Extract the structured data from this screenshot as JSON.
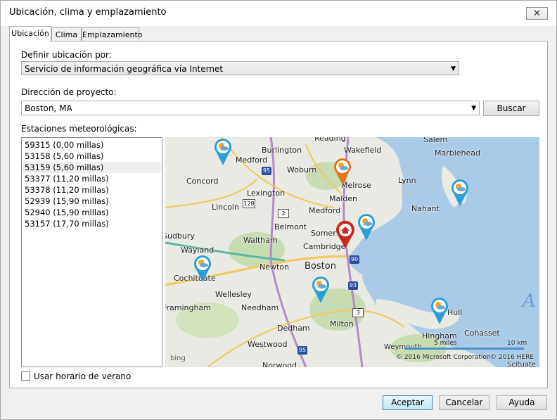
{
  "window": {
    "title": "Ubicación, clima y emplazamiento",
    "close": "✕"
  },
  "tabs": [
    {
      "label": "Ubicación"
    },
    {
      "label": "Clima"
    },
    {
      "label": "Emplazamiento"
    }
  ],
  "location": {
    "define_label": "Definir ubicación por:",
    "define_value": "Servicio de información geográfica vía Internet",
    "address_label": "Dirección de proyecto:",
    "address_value": "Boston, MA",
    "search_button": "Buscar"
  },
  "stations": {
    "label": "Estaciones meteorológicas:",
    "items": [
      "59315 (0,00 millas)",
      "53158 (5,60 millas)",
      "53159 (5,60 millas)",
      "53377 (11,20 millas)",
      "53378 (11,20 millas)",
      "52939 (15,90 millas)",
      "52940 (15,90 millas)",
      "53157 (17,70 millas)"
    ]
  },
  "map": {
    "places": [
      "Reading",
      "Wakefield",
      "Salem",
      "Burlington",
      "Medford",
      "Marblehead",
      "Woburn",
      "Concord",
      "Melrose",
      "Lynn",
      "Lexington",
      "Malden",
      "Nahant",
      "Lincoln",
      "Medford",
      "Belmont",
      "Somerville",
      "Sudbury",
      "Waltham",
      "Cambridge",
      "Wayland",
      "Newton",
      "Boston",
      "Cochituate",
      "Wellesley",
      "Framingham",
      "Needham",
      "Milton",
      "Hull",
      "Dedham",
      "Hingham",
      "Cohasset",
      "Westwood",
      "Weymouth",
      "Norwood",
      "Scituate"
    ],
    "shields": [
      "95",
      "128",
      "2",
      "90",
      "93",
      "3",
      "95",
      "3",
      "93"
    ],
    "scale_miles": "5 miles",
    "scale_km": "10 km",
    "copyright_ms": "© 2016 Microsoft Corporation",
    "copyright_here": "© 2016 HERE",
    "bing": "bing",
    "corner_letter": "A",
    "colors": {
      "water": "#a9cbe8",
      "land": "#e8eae3",
      "pin_blue": "#2a9fd6",
      "pin_orange": "#e8731a",
      "pin_home": "#c8281e"
    }
  },
  "dst_label": "Usar horario de verano",
  "footer": {
    "ok": "Aceptar",
    "cancel": "Cancelar",
    "help": "Ayuda"
  }
}
